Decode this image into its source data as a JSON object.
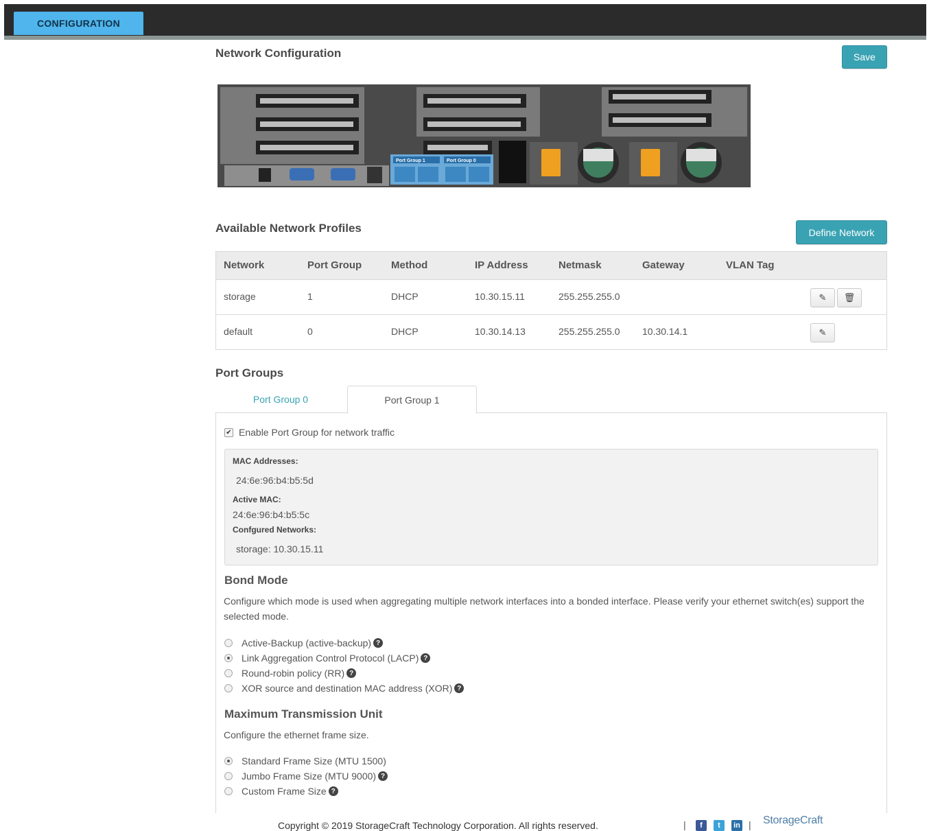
{
  "header": {
    "tab_label": "CONFIGURATION"
  },
  "page": {
    "title": "Network Configuration",
    "save_label": "Save"
  },
  "server": {
    "port_group_1": "Port Group 1",
    "port_group_0": "Port Group 0"
  },
  "profiles": {
    "title": "Available Network Profiles",
    "define_label": "Define Network",
    "columns": [
      "Network",
      "Port Group",
      "Method",
      "IP Address",
      "Netmask",
      "Gateway",
      "VLAN Tag"
    ],
    "rows": [
      {
        "network": "storage",
        "port_group": "1",
        "method": "DHCP",
        "ip": "10.30.15.11",
        "netmask": "255.255.255.0",
        "gateway": "",
        "vlan": ""
      },
      {
        "network": "default",
        "port_group": "0",
        "method": "DHCP",
        "ip": "10.30.14.13",
        "netmask": "255.255.255.0",
        "gateway": "10.30.14.1",
        "vlan": ""
      }
    ]
  },
  "port_groups": {
    "title": "Port Groups",
    "tabs": [
      "Port Group 0",
      "Port Group 1"
    ],
    "active_tab": "Port Group 1",
    "enable_label": "Enable Port Group for network traffic",
    "mac_label": "MAC Addresses:",
    "mac_value": "24:6e:96:b4:b5:5d",
    "active_mac_label": "Active MAC:",
    "active_mac_value": "24:6e:96:b4:b5:5c",
    "configured_label": "Confgured Networks:",
    "configured_value": "storage: 10.30.15.11"
  },
  "bond": {
    "title": "Bond Mode",
    "description": "Configure which mode is used when aggregating multiple network interfaces into a bonded interface. Please verify your ethernet switch(es) support the selected mode.",
    "options": [
      "Active-Backup (active-backup)",
      "Link Aggregation Control Protocol (LACP)",
      "Round-robin policy (RR)",
      "XOR source and destination MAC address (XOR)"
    ],
    "selected": "Link Aggregation Control Protocol (LACP)"
  },
  "mtu": {
    "title": "Maximum Transmission Unit",
    "description": "Configure the ethernet frame size.",
    "options": [
      "Standard Frame Size (MTU 1500)",
      "Jumbo Frame Size (MTU 9000)",
      "Custom Frame Size"
    ],
    "selected": "Standard Frame Size (MTU 1500)"
  },
  "footer": {
    "copyright": "Copyright © 2019 StorageCraft Technology Corporation. All rights reserved.",
    "brand": "StorageCraft"
  },
  "colors": {
    "accent": "#3aa3b3",
    "tab_blue": "#4fb5ec",
    "topbar": "#2b2b2b"
  }
}
